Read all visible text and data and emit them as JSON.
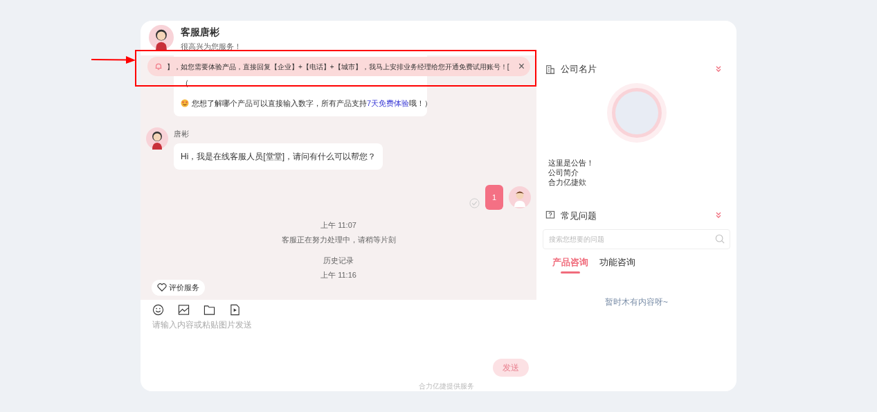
{
  "header": {
    "name": "客服唐彬",
    "subtitle": "很高兴为您服务！"
  },
  "notice": {
    "text": "】，如您需要体验产品，直接回复【企业】+【电话】+【城市】，我马上安排业务经理给您开通免费试用账号！[",
    "close": "×"
  },
  "messages": [
    {
      "kind": "agent-card",
      "lines": [
        "（",
        "您想了解哪个产品可以直接输入数字，所有产品支持**7天免费体验**哦！）"
      ]
    },
    {
      "kind": "agent",
      "sender": "唐彬",
      "text": "Hi，我是在线客服人员[堂堂]，请问有什么可以帮您？"
    },
    {
      "kind": "user",
      "text": "1",
      "read": true
    },
    {
      "kind": "system",
      "lines": [
        "上午 11:07",
        "客服正在努力处理中，请稍等片刻"
      ]
    },
    {
      "kind": "system",
      "lines": [
        "历史记录",
        "上午 11:16"
      ]
    }
  ],
  "rate_button": "评价服务",
  "composer": {
    "placeholder": "请输入内容或粘贴图片发送",
    "send": "发送",
    "send_disabled": true
  },
  "footer": "合力亿捷提供服务",
  "company_card": {
    "title": "公司名片",
    "lines": [
      "这里是公告！",
      "公司简介",
      "合力亿捷欸"
    ]
  },
  "faq": {
    "title": "常见问题",
    "search_placeholder": "搜索您想要的问题",
    "tabs": [
      {
        "label": "产品咨询",
        "selected": true
      },
      {
        "label": "功能咨询",
        "selected": false
      }
    ],
    "empty": "暂时木有内容呀~"
  }
}
